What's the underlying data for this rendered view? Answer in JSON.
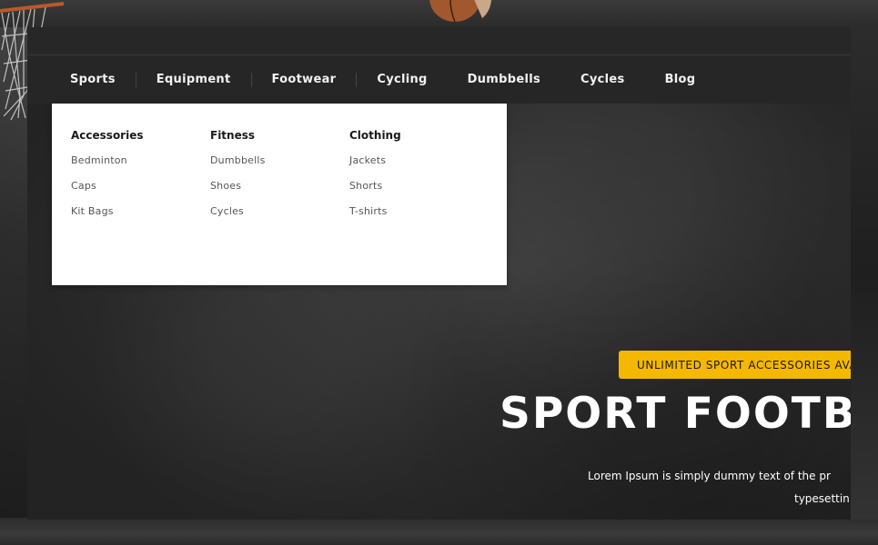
{
  "nav": {
    "items": [
      {
        "label": "Sports"
      },
      {
        "label": "Equipment"
      },
      {
        "label": "Footwear"
      },
      {
        "label": "Cycling"
      },
      {
        "label": "Dumbbells"
      },
      {
        "label": "Cycles"
      },
      {
        "label": "Blog"
      }
    ]
  },
  "mega_menu": {
    "columns": [
      {
        "heading": "Accessories",
        "links": [
          "Bedminton",
          "Caps",
          "Kit Bags"
        ]
      },
      {
        "heading": "Fitness",
        "links": [
          "Dumbbells",
          "Shoes",
          "Cycles"
        ]
      },
      {
        "heading": "Clothing",
        "links": [
          "Jackets",
          "Shorts",
          "T-shirts"
        ]
      }
    ]
  },
  "hero": {
    "badge": "UNLIMITED SPORT ACCESSORIES AVA",
    "title": "SPORT FOOTBA",
    "text_line1": "Lorem Ipsum is simply dummy text of the pr",
    "text_line2": "typesettin"
  },
  "colors": {
    "accent": "#f5b800",
    "nav_bg": "#262626",
    "menu_bg": "#ffffff"
  }
}
